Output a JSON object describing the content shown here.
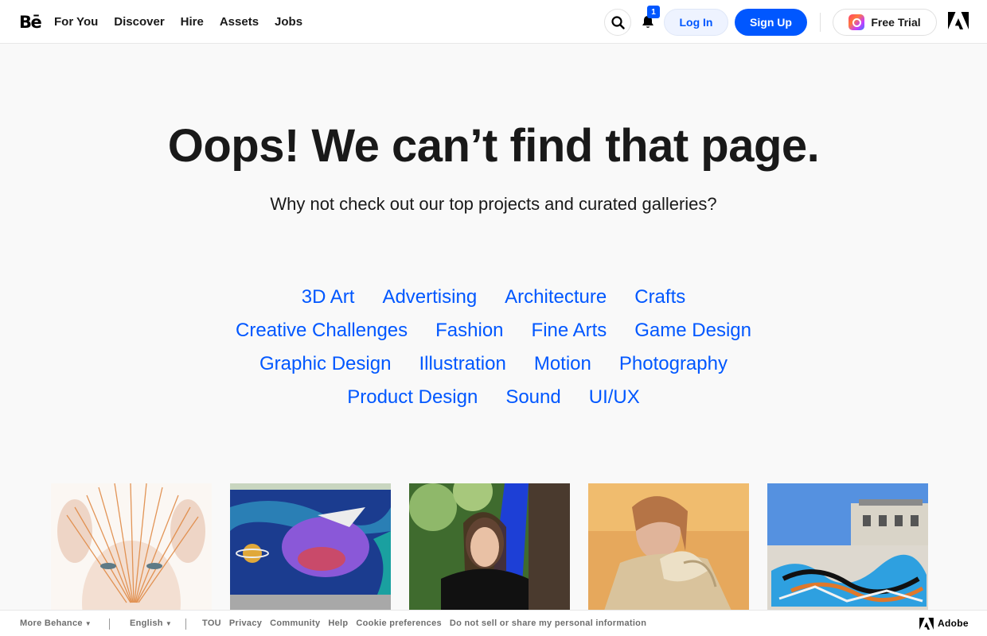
{
  "header": {
    "logo": "Bē",
    "nav": [
      "For You",
      "Discover",
      "Hire",
      "Assets",
      "Jobs"
    ],
    "notification_count": "1",
    "login_label": "Log In",
    "signup_label": "Sign Up",
    "trial_label": "Free Trial"
  },
  "main": {
    "headline": "Oops! We can’t find that page.",
    "subline": "Why not check out our top projects and curated galleries?",
    "categories": [
      [
        "3D Art",
        "Advertising",
        "Architecture",
        "Crafts"
      ],
      [
        "Creative Challenges",
        "Fashion",
        "Fine Arts",
        "Game Design"
      ],
      [
        "Graphic Design",
        "Illustration",
        "Motion",
        "Photography"
      ],
      [
        "Product Design",
        "Sound",
        "UI/UX"
      ]
    ],
    "gallery": [
      "face-with-strings",
      "graffiti-mural",
      "woman-blue-glove",
      "woman-silk-blouse",
      "graffiti-wall-building"
    ]
  },
  "footer": {
    "more": "More Behance",
    "language": "English",
    "links": [
      "TOU",
      "Privacy",
      "Community",
      "Help",
      "Cookie preferences",
      "Do not sell or share my personal information"
    ],
    "adobe": "Adobe"
  },
  "colors": {
    "accent": "#0057ff",
    "background": "#f9f9f9",
    "text": "#191919"
  }
}
